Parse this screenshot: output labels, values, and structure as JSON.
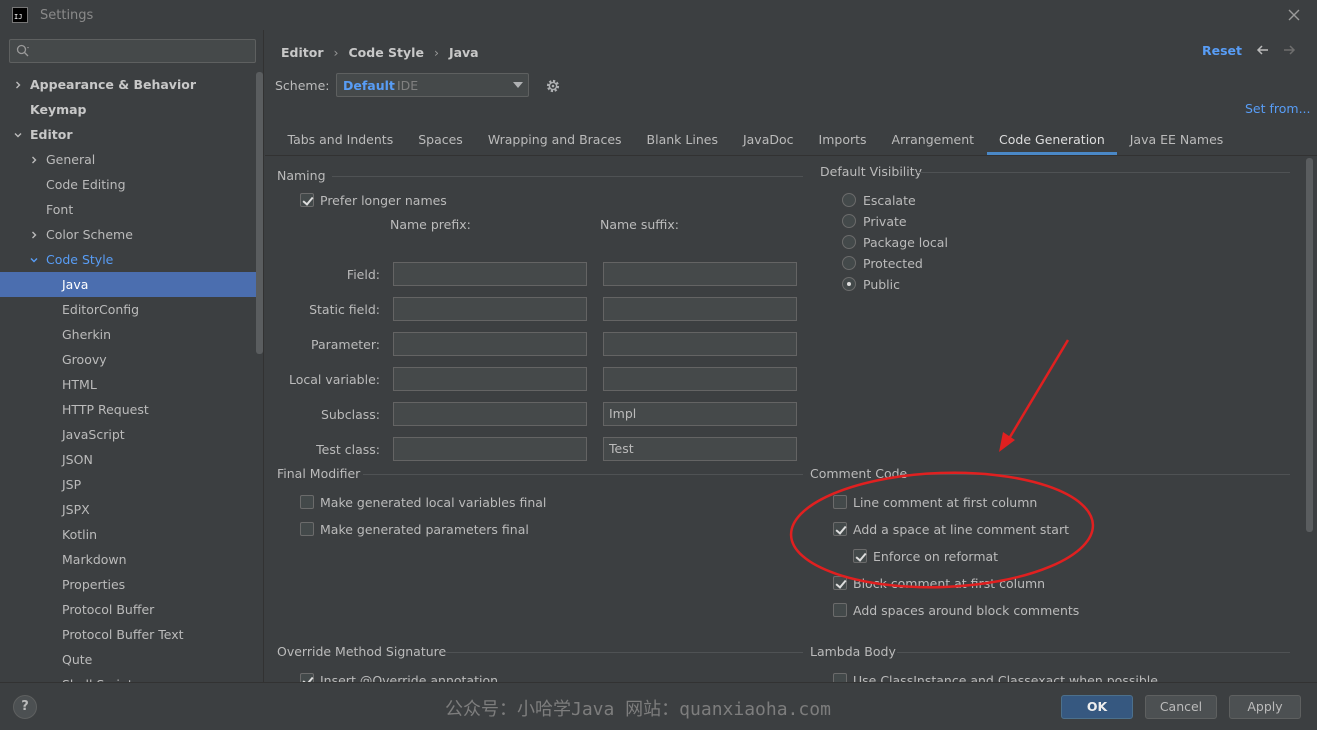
{
  "window": {
    "title": "Settings",
    "logo_text": "IJ"
  },
  "search": {
    "placeholder": ""
  },
  "sidebar": {
    "items": [
      {
        "label": "Appearance & Behavior",
        "level": 0,
        "expander": "right",
        "bold": true
      },
      {
        "label": "Keymap",
        "level": 0,
        "expander": "",
        "bold": true
      },
      {
        "label": "Editor",
        "level": 0,
        "expander": "down",
        "bold": true
      },
      {
        "label": "General",
        "level": 1,
        "expander": "right"
      },
      {
        "label": "Code Editing",
        "level": 1,
        "expander": ""
      },
      {
        "label": "Font",
        "level": 1,
        "expander": ""
      },
      {
        "label": "Color Scheme",
        "level": 1,
        "expander": "right"
      },
      {
        "label": "Code Style",
        "level": 1,
        "expander": "down",
        "link": true
      },
      {
        "label": "Java",
        "level": 2,
        "expander": "",
        "selected": true
      },
      {
        "label": "EditorConfig",
        "level": 2,
        "expander": ""
      },
      {
        "label": "Gherkin",
        "level": 2,
        "expander": ""
      },
      {
        "label": "Groovy",
        "level": 2,
        "expander": ""
      },
      {
        "label": "HTML",
        "level": 2,
        "expander": ""
      },
      {
        "label": "HTTP Request",
        "level": 2,
        "expander": ""
      },
      {
        "label": "JavaScript",
        "level": 2,
        "expander": ""
      },
      {
        "label": "JSON",
        "level": 2,
        "expander": ""
      },
      {
        "label": "JSP",
        "level": 2,
        "expander": ""
      },
      {
        "label": "JSPX",
        "level": 2,
        "expander": ""
      },
      {
        "label": "Kotlin",
        "level": 2,
        "expander": ""
      },
      {
        "label": "Markdown",
        "level": 2,
        "expander": ""
      },
      {
        "label": "Properties",
        "level": 2,
        "expander": ""
      },
      {
        "label": "Protocol Buffer",
        "level": 2,
        "expander": ""
      },
      {
        "label": "Protocol Buffer Text",
        "level": 2,
        "expander": ""
      },
      {
        "label": "Qute",
        "level": 2,
        "expander": ""
      },
      {
        "label": "Shell Script",
        "level": 2,
        "expander": ""
      }
    ]
  },
  "header": {
    "breadcrumb": [
      "Editor",
      "Code Style",
      "Java"
    ],
    "separator": "›",
    "reset_label": "Reset",
    "scheme_label": "Scheme:",
    "scheme_value": "Default",
    "scheme_sub": "IDE",
    "set_from_label": "Set from..."
  },
  "tabs": [
    {
      "label": "Tabs and Indents"
    },
    {
      "label": "Spaces"
    },
    {
      "label": "Wrapping and Braces"
    },
    {
      "label": "Blank Lines"
    },
    {
      "label": "JavaDoc"
    },
    {
      "label": "Imports"
    },
    {
      "label": "Arrangement"
    },
    {
      "label": "Code Generation",
      "active": true
    },
    {
      "label": "Java EE Names"
    }
  ],
  "naming": {
    "title": "Naming",
    "prefer_longer": {
      "label": "Prefer longer names",
      "checked": true
    },
    "prefix_header": "Name prefix:",
    "suffix_header": "Name suffix:",
    "rows": [
      {
        "label": "Field:",
        "prefix": "",
        "suffix": ""
      },
      {
        "label": "Static field:",
        "prefix": "",
        "suffix": ""
      },
      {
        "label": "Parameter:",
        "prefix": "",
        "suffix": ""
      },
      {
        "label": "Local variable:",
        "prefix": "",
        "suffix": ""
      },
      {
        "label": "Subclass:",
        "prefix": "",
        "suffix": "Impl"
      },
      {
        "label": "Test class:",
        "prefix": "",
        "suffix": "Test"
      }
    ]
  },
  "visibility": {
    "title": "Default Visibility",
    "options": [
      {
        "label": "Escalate",
        "checked": false
      },
      {
        "label": "Private",
        "checked": false
      },
      {
        "label": "Package local",
        "checked": false
      },
      {
        "label": "Protected",
        "checked": false
      },
      {
        "label": "Public",
        "checked": true
      }
    ]
  },
  "final_modifier": {
    "title": "Final Modifier",
    "options": [
      {
        "label": "Make generated local variables final",
        "checked": false
      },
      {
        "label": "Make generated parameters final",
        "checked": false
      }
    ]
  },
  "comment_code": {
    "title": "Comment Code",
    "options": [
      {
        "label": "Line comment at first column",
        "checked": false,
        "indent": 0
      },
      {
        "label": "Add a space at line comment start",
        "checked": true,
        "indent": 0
      },
      {
        "label": "Enforce on reformat",
        "checked": true,
        "indent": 1
      },
      {
        "label": "Block comment at first column",
        "checked": true,
        "indent": 0
      },
      {
        "label": "Add spaces around block comments",
        "checked": false,
        "indent": 0
      }
    ]
  },
  "override": {
    "title": "Override Method Signature",
    "options": [
      {
        "label": "Insert @Override annotation",
        "checked": true
      }
    ]
  },
  "lambda": {
    "title": "Lambda Body",
    "options": [
      {
        "label": "Use ClassInstance and Classexact when possible",
        "checked": false
      }
    ]
  },
  "footer": {
    "help_label": "?",
    "watermark": "公众号：小哈学Java 网站：quanxiaoha.com",
    "ok_label": "OK",
    "cancel_label": "Cancel",
    "apply_label": "Apply"
  },
  "colors": {
    "accent": "#589df6",
    "selection": "#4b6eaf",
    "annotation": "#e02020"
  }
}
